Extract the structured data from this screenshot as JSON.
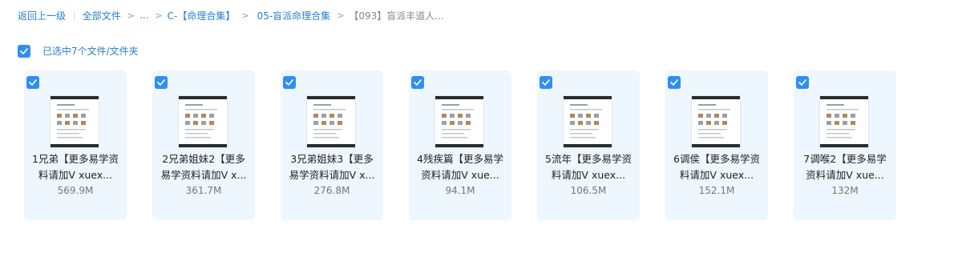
{
  "breadcrumb": {
    "back": "返回上一级",
    "all_files": "全部文件",
    "ellipsis": "...",
    "level1": "C-【命理合集】",
    "level2": "05-盲派命理合集",
    "current": "【093】盲派丰道人..."
  },
  "selection": {
    "checked": true,
    "label": "已选中7个文件/文件夹"
  },
  "files": [
    {
      "name_line1": "1兄弟【更多易学资",
      "name_line2": "料请加V xuex...",
      "size": "569.9M",
      "checked": true,
      "thumb_icon": "video-thumbnail-icon"
    },
    {
      "name_line1": "2兄弟姐妹2【更多",
      "name_line2": "易学资料请加V x...",
      "size": "361.7M",
      "checked": true,
      "thumb_icon": "video-thumbnail-icon"
    },
    {
      "name_line1": "3兄弟姐妹3【更多",
      "name_line2": "易学资料请加V x...",
      "size": "276.8M",
      "checked": true,
      "thumb_icon": "video-thumbnail-icon"
    },
    {
      "name_line1": "4残疾篇【更多易学",
      "name_line2": "资料请加V xue...",
      "size": "94.1M",
      "checked": true,
      "thumb_icon": "video-thumbnail-icon"
    },
    {
      "name_line1": "5流年【更多易学资",
      "name_line2": "料请加V xuex...",
      "size": "106.5M",
      "checked": true,
      "thumb_icon": "video-thumbnail-icon"
    },
    {
      "name_line1": "6调侯【更多易学资",
      "name_line2": "料请加V xuex...",
      "size": "152.1M",
      "checked": true,
      "thumb_icon": "video-thumbnail-icon"
    },
    {
      "name_line1": "7调喉2【更多易学",
      "name_line2": "资料请加V xue...",
      "size": "132M",
      "checked": true,
      "thumb_icon": "video-thumbnail-icon"
    }
  ],
  "colors": {
    "accent": "#2f8ef4",
    "link": "#2a7fd4",
    "card_bg": "#eef6fe"
  }
}
